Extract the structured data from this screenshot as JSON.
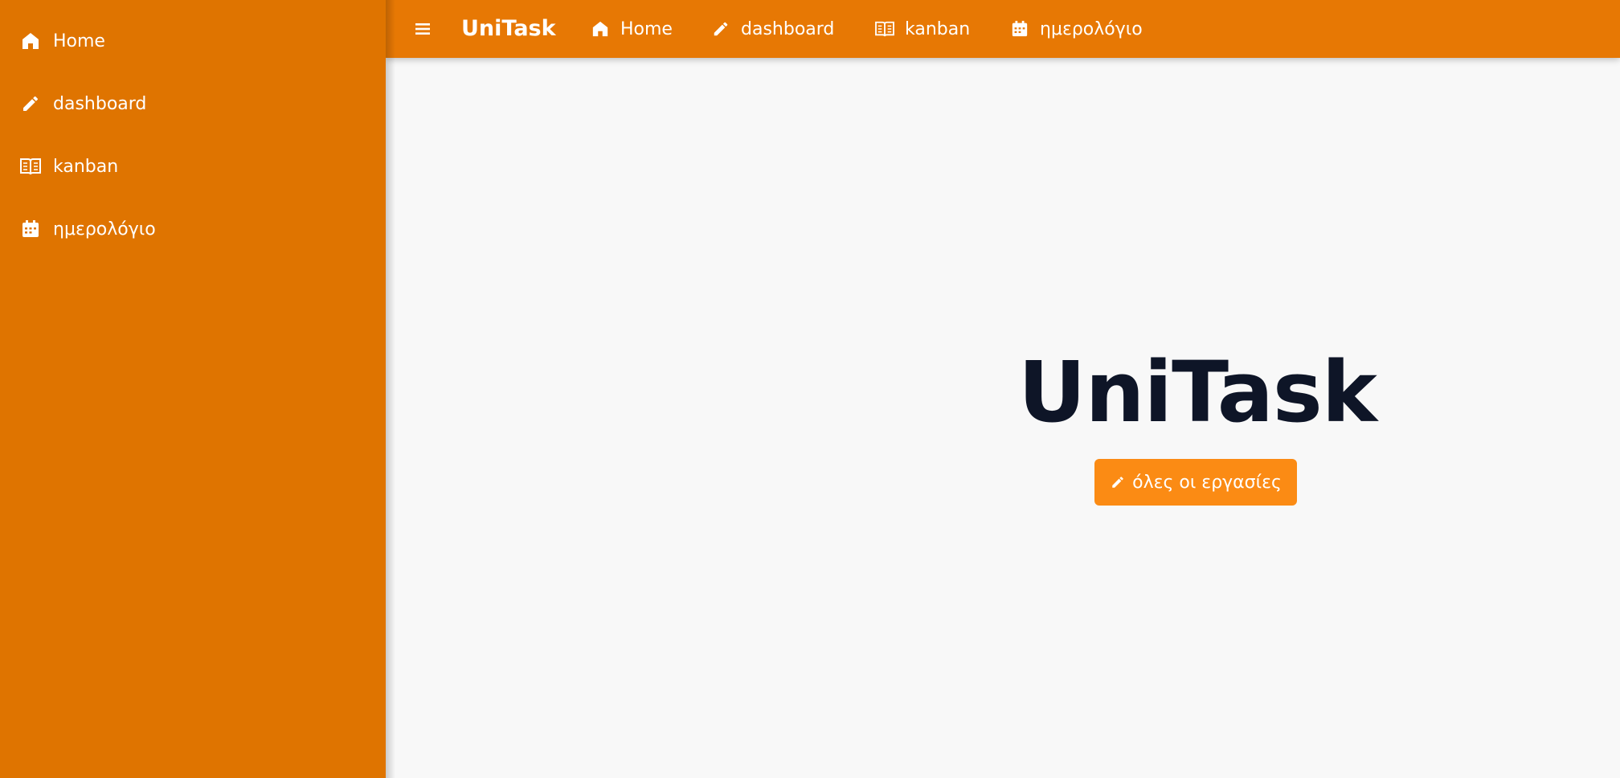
{
  "sidebar": {
    "items": [
      {
        "label": "Home",
        "icon": "home-icon"
      },
      {
        "label": "dashboard",
        "icon": "pencil-icon"
      },
      {
        "label": "kanban",
        "icon": "book-open-icon"
      },
      {
        "label": "ημερολόγιο",
        "icon": "calendar-icon"
      }
    ]
  },
  "topbar": {
    "menu_icon": "hamburger-icon",
    "brand": "UniTask",
    "nav": [
      {
        "label": "Home",
        "icon": "home-icon"
      },
      {
        "label": "dashboard",
        "icon": "pencil-icon"
      },
      {
        "label": "kanban",
        "icon": "book-open-icon"
      },
      {
        "label": "ημερολόγιο",
        "icon": "calendar-icon"
      }
    ]
  },
  "hero": {
    "title": "UniTask",
    "button_label": "όλες οι εργασίες",
    "button_icon": "pencil-icon"
  },
  "colors": {
    "sidebar_bg": "#df7400",
    "topbar_bg": "#e77804",
    "button_bg": "#fb8b14",
    "title_text": "#0e1527",
    "page_bg": "#f8f8f8"
  }
}
